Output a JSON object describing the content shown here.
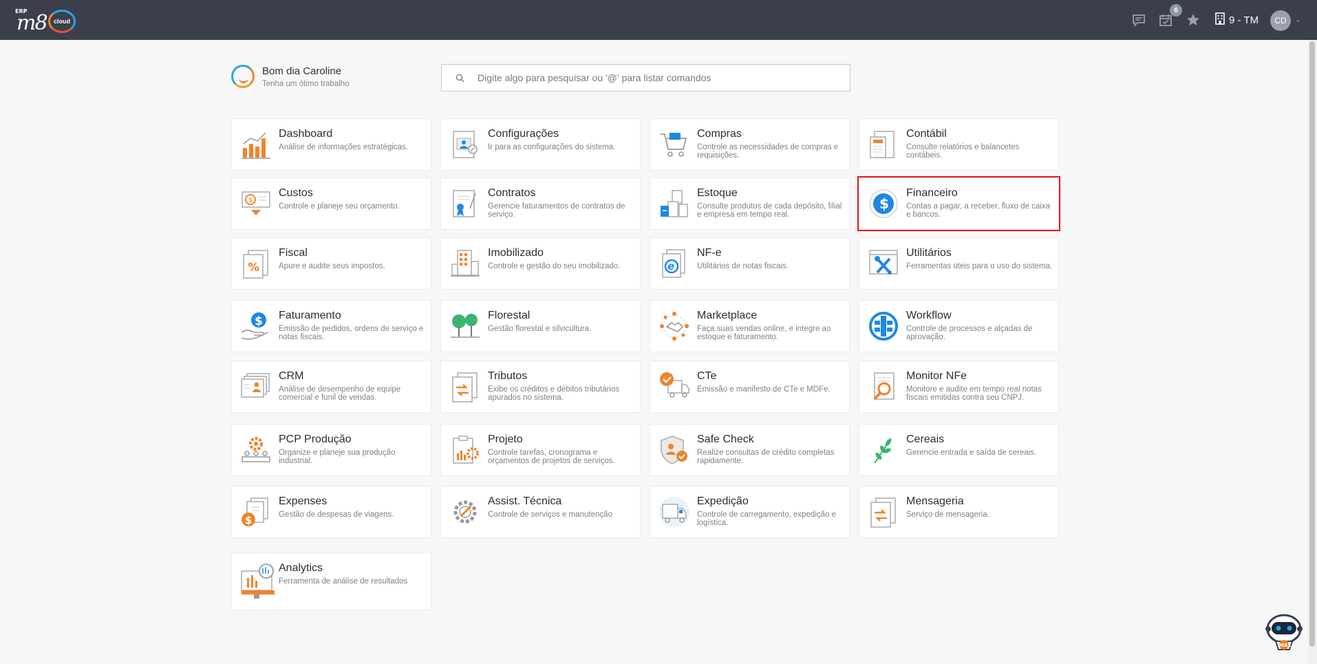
{
  "app": {
    "logo_erp": "ERP",
    "logo_mark": "m8",
    "logo_cloud": "cloud"
  },
  "topbar": {
    "notification_count": "6",
    "company": "9 - TM",
    "avatar_initials": "CD"
  },
  "greeting": {
    "title": "Bom dia Caroline",
    "subtitle": "Tenha um ótimo trabalho"
  },
  "search": {
    "placeholder": "Digite algo para pesquisar ou '@' para listar comandos"
  },
  "modules": [
    {
      "title": "Dashboard",
      "desc": "Análise de informações estratégicas."
    },
    {
      "title": "Configurações",
      "desc": "Ir para as configurações do sistema."
    },
    {
      "title": "Compras",
      "desc": "Controle as necessidades de compras e requisições."
    },
    {
      "title": "Contábil",
      "desc": "Consulte relatórios e balancetes contábeis."
    },
    {
      "title": "Custos",
      "desc": "Controle e planeje seu orçamento."
    },
    {
      "title": "Contratos",
      "desc": "Gerencie faturamentos de contratos de serviço."
    },
    {
      "title": "Estoque",
      "desc": "Consulte produtos de cada depósito, filial e empresa em tempo real."
    },
    {
      "title": "Financeiro",
      "desc": "Contas a pagar, a receber, fluxo de caixa e bancos."
    },
    {
      "title": "Fiscal",
      "desc": "Apure e audite seus impostos."
    },
    {
      "title": "Imobilizado",
      "desc": "Controle e gestão do seu imobilizado."
    },
    {
      "title": "NF-e",
      "desc": "Utilitários de notas fiscais."
    },
    {
      "title": "Utilitários",
      "desc": "Ferramentas úteis para o uso do sistema."
    },
    {
      "title": "Faturamento",
      "desc": "Emissão de pedidos, ordens de serviço e notas fiscais."
    },
    {
      "title": "Florestal",
      "desc": "Gestão florestal e silvicultura."
    },
    {
      "title": "Marketplace",
      "desc": "Faça suas vendas online, e integre ao estoque e faturamento."
    },
    {
      "title": "Workflow",
      "desc": "Controle de processos e alçadas de aprovação."
    },
    {
      "title": "CRM",
      "desc": "Análise de desempenho de equipe comercial e funil de vendas."
    },
    {
      "title": "Tributos",
      "desc": "Exibe os créditos e débitos tributários apurados no sistema."
    },
    {
      "title": "CTe",
      "desc": "Emissão e manifesto de CTe e MDFe."
    },
    {
      "title": "Monitor NFe",
      "desc": "Monitore e audite em tempo real notas fiscais emitidas contra seu CNPJ."
    },
    {
      "title": "PCP Produção",
      "desc": "Organize e planeje sua produção industrial."
    },
    {
      "title": "Projeto",
      "desc": "Controle tarefas, cronograma e orçamentos de projetos de serviços."
    },
    {
      "title": "Safe Check",
      "desc": "Realize consultas de crédito completas rapidamente."
    },
    {
      "title": "Cereais",
      "desc": "Gerencie entrada e saída de cereais."
    },
    {
      "title": "Expenses",
      "desc": "Gestão de despesas de viagens."
    },
    {
      "title": "Assist. Técnica",
      "desc": "Controle de serviços e manutenção"
    },
    {
      "title": "Expedição",
      "desc": "Controle de carregamento, expedição e logística."
    },
    {
      "title": "Mensageria",
      "desc": "Serviço de mensageria."
    },
    {
      "title": "Analytics",
      "desc": "Ferramenta de análise de resultados"
    }
  ],
  "mascot": {
    "label": "MAX"
  },
  "colors": {
    "topbar": "#3b3f4c",
    "accent_orange": "#f0842b",
    "accent_blue": "#1e88e5",
    "selected_border": "#e0181e"
  }
}
